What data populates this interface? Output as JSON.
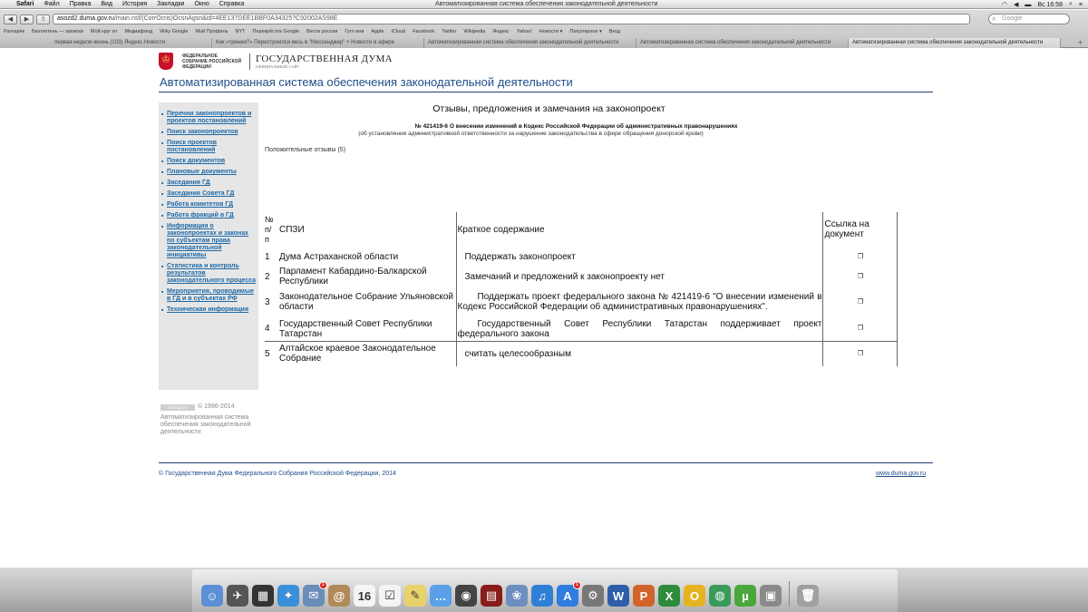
{
  "menubar": {
    "apple": "",
    "items": [
      "Safari",
      "Файл",
      "Правка",
      "Вид",
      "История",
      "Закладки",
      "Окно",
      "Справка"
    ],
    "window_title": "Автоматизированная система обеспечения законодательной деятельности",
    "clock": "Вс 16:58"
  },
  "browser": {
    "url_host": "asozd2.duma.gov.ru",
    "url_path": "/main.nsf/(CorrOcris)OcsnAgsn&id=4EE137DEE1BBF0A34325?C92002AS98E",
    "search_placeholder": "Google",
    "bookmarks": [
      "Рагнарёк",
      "Бюллетень — записки",
      "Мой круг ит",
      "Медиафонд",
      "Wiky Google",
      "Мой Профиль",
      "NYT",
      "Перекрёсток Google",
      "Вести россия",
      "Гугл инв",
      "Apple",
      "iCloud",
      "Facebook",
      "Twitter",
      "Wikipedia",
      "Яндекс",
      "Yahoo!",
      "Новости ▾",
      "Популярное ▾",
      "Вход"
    ],
    "tabs": [
      "первая неделя-жизнь (103) Яндекс.Новости",
      "Как «тренеи?» Перестроился весь в \"Мессенджер\" + Новости в эфире",
      "Автоматизированная система обеспечения законодательной деятельности",
      "Автоматизированная система обеспечения законодательной деятельности",
      "Автоматизированная система обеспечения законодательной деятельности"
    ],
    "active_tab": 4
  },
  "site": {
    "logo_small": "ФЕДЕРАЛЬНОЕ СОБРАНИЕ РОССИЙСКОЙ ФЕДЕРАЦИИ",
    "logo_big": "ГОСУДАРСТВЕННАЯ ДУМА",
    "logo_big_sub": "ОФИЦИАЛЬНЫЙ САЙТ",
    "title": "Автоматизированная система обеспечения законодательной деятельности"
  },
  "sidebar": {
    "items": [
      {
        "label": "Перечни законопроектов и проектов постановлений"
      },
      {
        "label": "Поиск законопроектов"
      },
      {
        "label": "Поиск проектов постановлений"
      },
      {
        "label": "Поиск документов"
      },
      {
        "label": "Плановые документы"
      },
      {
        "label": "Заседания ГД"
      },
      {
        "label": "Заседания Совета ГД"
      },
      {
        "label": "Работа комитетов ГД"
      },
      {
        "label": "Работа фракций в ГД"
      },
      {
        "label": "Информация о законопроектах и законах по субъектам права законодательной инициативы"
      },
      {
        "label": "Статистика и контроль результатов законодательного процесса"
      },
      {
        "label": "Мероприятия, проводимые в ГД и в субъектах РФ"
      },
      {
        "label": "Техническая информация"
      }
    ],
    "copyright_badge": "АСОЗД 2.0",
    "copyright_years": "© 1996-2014",
    "copyright_text": "Автоматизированная система обеспечения законодательной деятельности"
  },
  "main": {
    "heading": "Отзывы, предложения и замечания на законопроект",
    "bill_title": "№ 421419-6 О внесении изменений в Кодекс Российской Федерации об административных правонарушениях",
    "bill_subtitle": "(об установлении административной ответственности за нарушение законодательства в сфере обращения донорской крови)",
    "reviews_caption": "Положительные отзывы (5)",
    "table": {
      "col_num": "№ п/ п",
      "col_org": "СПЗИ",
      "col_summary": "Краткое содержание",
      "col_link": "Ссылка на документ",
      "rows": [
        {
          "num": "1",
          "org": "Дума Астраханской области",
          "summary": "Поддержать законопроект"
        },
        {
          "num": "2",
          "org": "Парламент Кабардино-Балкарской Республики",
          "summary": "Замечаний и предложений к законопроекту нет"
        },
        {
          "num": "3",
          "org": "Законодательное Собрание Ульяновской области",
          "summary": "Поддержать проект федерального закона № 421419-6 \"О внесении изменений в Кодекс Российской Федерации об административных правонарушениях\"."
        },
        {
          "num": "4",
          "org": "Государственный Совет Республики Татарстан",
          "summary": "Государственный Совет Республики Татарстан поддерживает проект федерального закона"
        },
        {
          "num": "5",
          "org": "Алтайское краевое Законодательное Собрание",
          "summary": "считать целесообразным"
        }
      ]
    }
  },
  "footer": {
    "left": "© Государственная Дума Федерального Собрания Российской Федерации, 2014",
    "right": "www.duma.gov.ru"
  },
  "dock": {
    "icons": [
      {
        "name": "finder-icon",
        "color": "#5b8fd6",
        "glyph": "☺"
      },
      {
        "name": "launchpad-icon",
        "color": "#555555",
        "glyph": "✈"
      },
      {
        "name": "dashboard-icon",
        "color": "#333333",
        "glyph": "▦"
      },
      {
        "name": "safari-icon",
        "color": "#3a8fd9",
        "glyph": "✦"
      },
      {
        "name": "mail-icon",
        "color": "#6a8db8",
        "glyph": "✉",
        "badge": "1"
      },
      {
        "name": "contacts-icon",
        "color": "#b08a58",
        "glyph": "@"
      },
      {
        "name": "calendar-icon",
        "color": "#f4f4f4",
        "glyph": "16"
      },
      {
        "name": "reminders-icon",
        "color": "#f4f4f4",
        "glyph": "☑"
      },
      {
        "name": "notes-icon",
        "color": "#e8d36a",
        "glyph": "✎"
      },
      {
        "name": "messages-icon",
        "color": "#5aa0e8",
        "glyph": "…"
      },
      {
        "name": "facetime-icon",
        "color": "#444444",
        "glyph": "◉"
      },
      {
        "name": "photo-booth-icon",
        "color": "#8a1c1c",
        "glyph": "▤"
      },
      {
        "name": "iphoto-icon",
        "color": "#6d8fbf",
        "glyph": "❀"
      },
      {
        "name": "itunes-icon",
        "color": "#2f7fd6",
        "glyph": "♫"
      },
      {
        "name": "app-store-icon",
        "color": "#2e7ce0",
        "glyph": "A",
        "badge": "1"
      },
      {
        "name": "system-preferences-icon",
        "color": "#777777",
        "glyph": "⚙"
      },
      {
        "name": "word-icon",
        "color": "#2f5ea8",
        "glyph": "W"
      },
      {
        "name": "powerpoint-icon",
        "color": "#d2642b",
        "glyph": "P"
      },
      {
        "name": "excel-icon",
        "color": "#2e8b3e",
        "glyph": "X"
      },
      {
        "name": "outlook-icon",
        "color": "#e5b320",
        "glyph": "O"
      },
      {
        "name": "globe-icon",
        "color": "#3a9a5a",
        "glyph": "◍"
      },
      {
        "name": "utorrent-icon",
        "color": "#4aa83a",
        "glyph": "µ"
      },
      {
        "name": "preview-icon",
        "color": "#8a8a8a",
        "glyph": "▣"
      },
      {
        "name": "trash-icon",
        "color": "#a0a0a0",
        "glyph": "🗑"
      }
    ]
  }
}
